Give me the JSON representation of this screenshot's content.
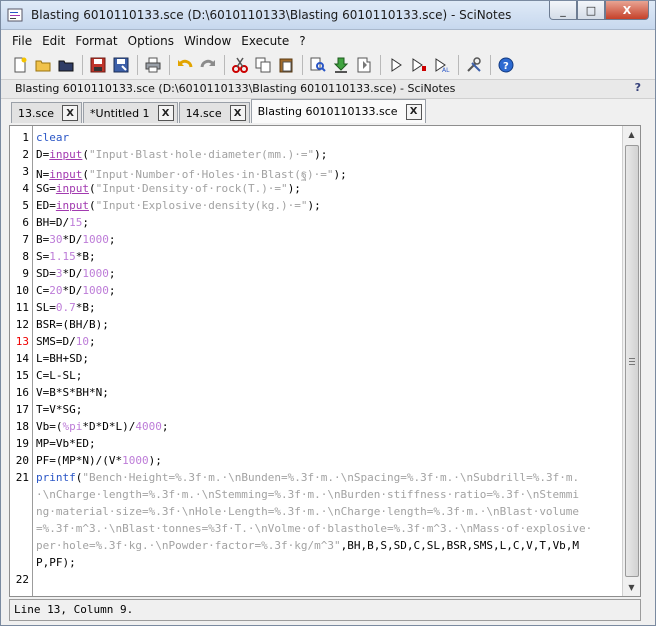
{
  "window": {
    "title": "Blasting 6010110133.sce (D:\\6010110133\\Blasting 6010110133.sce) - SciNotes",
    "minimize": "_",
    "maximize": "□",
    "close": "X"
  },
  "menu": [
    "File",
    "Edit",
    "Format",
    "Options",
    "Window",
    "Execute",
    "?"
  ],
  "toolbar": {
    "icons": [
      "new-file-icon",
      "open-folder-icon",
      "open-recent-icon",
      "save-icon",
      "save-as-icon",
      "print-icon",
      "undo-icon",
      "redo-icon",
      "cut-icon",
      "copy-icon",
      "paste-icon",
      "find-icon",
      "load-into-scilab-icon",
      "save-and-execute-icon",
      "execute-icon",
      "execute-until-icon",
      "comment-icon",
      "settings-icon",
      "help-icon"
    ]
  },
  "pathbar": {
    "text": "Blasting 6010110133.sce (D:\\6010110133\\Blasting 6010110133.sce) - SciNotes",
    "help": "?"
  },
  "tabs": [
    {
      "label": "13.sce",
      "close": "X"
    },
    {
      "label": "*Untitled 1",
      "close": "X"
    },
    {
      "label": "14.sce",
      "close": "X"
    },
    {
      "label": "Blasting 6010110133.sce",
      "close": "X"
    }
  ],
  "editor": {
    "current_line": 13,
    "gutter": [
      {
        "n": "1",
        "row": 0
      },
      {
        "n": "2",
        "row": 1
      },
      {
        "n": "3",
        "row": 2
      },
      {
        "n": "4",
        "row": 3
      },
      {
        "n": "5",
        "row": 4
      },
      {
        "n": "6",
        "row": 5
      },
      {
        "n": "7",
        "row": 6
      },
      {
        "n": "8",
        "row": 7
      },
      {
        "n": "9",
        "row": 8
      },
      {
        "n": "10",
        "row": 9
      },
      {
        "n": "11",
        "row": 10
      },
      {
        "n": "12",
        "row": 11
      },
      {
        "n": "13",
        "row": 12
      },
      {
        "n": "14",
        "row": 13
      },
      {
        "n": "15",
        "row": 14
      },
      {
        "n": "16",
        "row": 15
      },
      {
        "n": "17",
        "row": 16
      },
      {
        "n": "18",
        "row": 17
      },
      {
        "n": "19",
        "row": 18
      },
      {
        "n": "20",
        "row": 19
      },
      {
        "n": "21",
        "row": 20
      },
      {
        "n": "22",
        "row": 26
      }
    ],
    "lines": [
      [
        [
          "kw",
          "clear"
        ]
      ],
      [
        [
          "op",
          "D="
        ],
        [
          "fn",
          "input"
        ],
        [
          "op",
          "("
        ],
        [
          "str",
          "\"Input·Blast·hole·diameter(mm.)·=\""
        ],
        [
          "op",
          ");"
        ]
      ],
      [
        [
          "op",
          "N="
        ],
        [
          "fn",
          "input"
        ],
        [
          "op",
          "("
        ],
        [
          "str",
          "\"Input·Number·of·Holes·in·Blast(ฐ)·=\""
        ],
        [
          "op",
          ");"
        ]
      ],
      [
        [
          "op",
          "SG="
        ],
        [
          "fn",
          "input"
        ],
        [
          "op",
          "("
        ],
        [
          "str",
          "\"Input·Density·of·rock(T.)·=\""
        ],
        [
          "op",
          ");"
        ]
      ],
      [
        [
          "op",
          "ED="
        ],
        [
          "fn",
          "input"
        ],
        [
          "op",
          "("
        ],
        [
          "str",
          "\"Input·Explosive·density(kg.)·=\""
        ],
        [
          "op",
          ");"
        ]
      ],
      [
        [
          "op",
          "BH=D/"
        ],
        [
          "num",
          "15"
        ],
        [
          "op",
          ";"
        ]
      ],
      [
        [
          "op",
          "B="
        ],
        [
          "num",
          "30"
        ],
        [
          "op",
          "*D/"
        ],
        [
          "num",
          "1000"
        ],
        [
          "op",
          ";"
        ]
      ],
      [
        [
          "op",
          "S="
        ],
        [
          "num",
          "1.15"
        ],
        [
          "op",
          "*B;"
        ]
      ],
      [
        [
          "op",
          "SD="
        ],
        [
          "num",
          "3"
        ],
        [
          "op",
          "*D/"
        ],
        [
          "num",
          "1000"
        ],
        [
          "op",
          ";"
        ]
      ],
      [
        [
          "op",
          "C="
        ],
        [
          "num",
          "20"
        ],
        [
          "op",
          "*D/"
        ],
        [
          "num",
          "1000"
        ],
        [
          "op",
          ";"
        ]
      ],
      [
        [
          "op",
          "SL="
        ],
        [
          "num",
          "0.7"
        ],
        [
          "op",
          "*B;"
        ]
      ],
      [
        [
          "op",
          "BSR=(BH/B);"
        ]
      ],
      [
        [
          "op",
          "SMS=D/"
        ],
        [
          "num",
          "10"
        ],
        [
          "op",
          ";"
        ]
      ],
      [
        [
          "op",
          "L=BH+SD;"
        ]
      ],
      [
        [
          "op",
          "C=L-SL;"
        ]
      ],
      [
        [
          "op",
          "V=B*S*BH*N;"
        ]
      ],
      [
        [
          "op",
          "T=V*SG;"
        ]
      ],
      [
        [
          "op",
          "Vb=("
        ],
        [
          "num",
          "%pi"
        ],
        [
          "op",
          "*D*D*L)/"
        ],
        [
          "num",
          "4000"
        ],
        [
          "op",
          ";"
        ]
      ],
      [
        [
          "op",
          "MP=Vb*ED;"
        ]
      ],
      [
        [
          "op",
          "PF=(MP*N)/(V*"
        ],
        [
          "num",
          "1000"
        ],
        [
          "op",
          ");"
        ]
      ],
      [
        [
          "kw",
          "printf"
        ],
        [
          "op",
          "("
        ],
        [
          "str",
          "\"Bench·Height=%.3f·m.·\\nBunden=%.3f·m.·\\nSpacing=%.3f·m.·\\nSubdrill=%.3f·m."
        ]
      ],
      [
        [
          "str",
          "·\\nCharge·length=%.3f·m.·\\nStemming=%.3f·m.·\\nBurden·stiffness·ratio=%.3f·\\nStemmi"
        ]
      ],
      [
        [
          "str",
          "ng·material·size=%.3f·\\nHole·Length=%.3f·m.·\\nCharge·length=%.3f·m.·\\nBlast·volume"
        ]
      ],
      [
        [
          "str",
          "=%.3f·m^3.·\\nBlast·tonnes=%3f·T.·\\nVolme·of·blasthole=%.3f·m^3.·\\nMass·of·explosive·"
        ]
      ],
      [
        [
          "str",
          "per·hole=%.3f·kg.·\\nPowder·factor=%.3f·kg/m^3\""
        ],
        [
          "op",
          ",BH,B,S,SD,C,SL,BSR,SMS,L,C,V,T,Vb,M"
        ]
      ],
      [
        [
          "op",
          "P,PF);"
        ]
      ],
      []
    ]
  },
  "status": {
    "text": "Line 13, Column 9."
  }
}
